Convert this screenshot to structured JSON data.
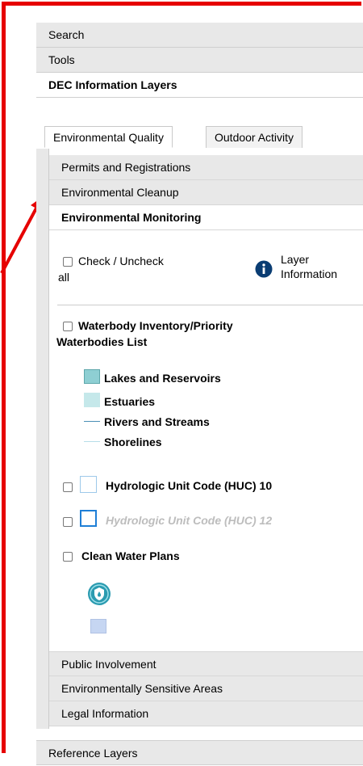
{
  "outer_menu": {
    "search_label": "Search",
    "tools_label": "Tools",
    "dec_layers_label": "DEC Information Layers",
    "reference_layers_label": "Reference Layers"
  },
  "tabs": {
    "environmental_quality": "Environmental Quality",
    "outdoor_activity": "Outdoor Activity"
  },
  "sections": {
    "permits": "Permits and Registrations",
    "cleanup": "Environmental Cleanup",
    "monitoring": "Environmental Monitoring",
    "public": "Public Involvement",
    "sensitive": "Environmentally Sensitive Areas",
    "legal": "Legal Information"
  },
  "monitoring": {
    "check_all_line1": "Check / Uncheck",
    "check_all_line2": "all",
    "layer_info_line1": "Layer",
    "layer_info_line2": "Information",
    "waterbody_line1": "Waterbody Inventory/Priority",
    "waterbody_line2": "Waterbodies List",
    "legend": {
      "lakes": "Lakes and Reservoirs",
      "estuaries": "Estuaries",
      "rivers": "Rivers and Streams",
      "shorelines": "Shorelines"
    },
    "huc10": "Hydrologic Unit Code (HUC) 10",
    "huc12": "Hydrologic Unit Code (HUC) 12",
    "clean_water": "Clean Water Plans"
  },
  "colors": {
    "annotation_red": "#e60000",
    "lakes": "#8ecfd3",
    "estuaries": "#c5e8ea",
    "rivers": "#4a8fb5",
    "shorelines": "#b7dde8",
    "huc10": "#9ec9ea",
    "huc12": "#1f7fd6",
    "clean_water_icon": "#2b9bb0",
    "info_icon": "#0a3d73"
  }
}
